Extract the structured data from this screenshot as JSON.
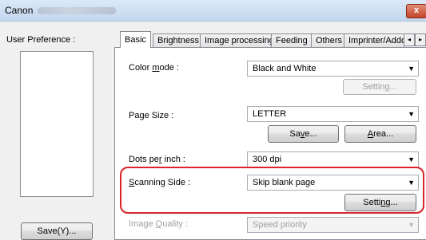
{
  "window": {
    "title": "Canon",
    "close_label": "x"
  },
  "preferences": {
    "label": "User Preference :",
    "save_label": "Save(Y)..."
  },
  "tabs": [
    {
      "label": "Basic"
    },
    {
      "label": "Brightness"
    },
    {
      "label": "Image processing"
    },
    {
      "label": "Feeding"
    },
    {
      "label": "Others"
    },
    {
      "label": "Imprinter/Addo"
    }
  ],
  "tab_scroll": {
    "left": "◂",
    "right": "▸"
  },
  "basic": {
    "color_mode": {
      "label": "Color mode :",
      "value": "Black and White",
      "setting_label": "Setting..."
    },
    "page_size": {
      "label": "Page Size :",
      "value": "LETTER",
      "save_label": "Save...",
      "area_label": "Area..."
    },
    "dpi": {
      "label": "Dots per inch :",
      "value": "300 dpi"
    },
    "scanning_side": {
      "label": "Scanning Side :",
      "value": "Skip blank page",
      "setting_label": "Setting..."
    },
    "image_quality": {
      "label": "Image Quality :",
      "value": "Speed priority"
    }
  },
  "colors": {
    "highlight": "#d9242a",
    "close_button": "#c3432a"
  }
}
